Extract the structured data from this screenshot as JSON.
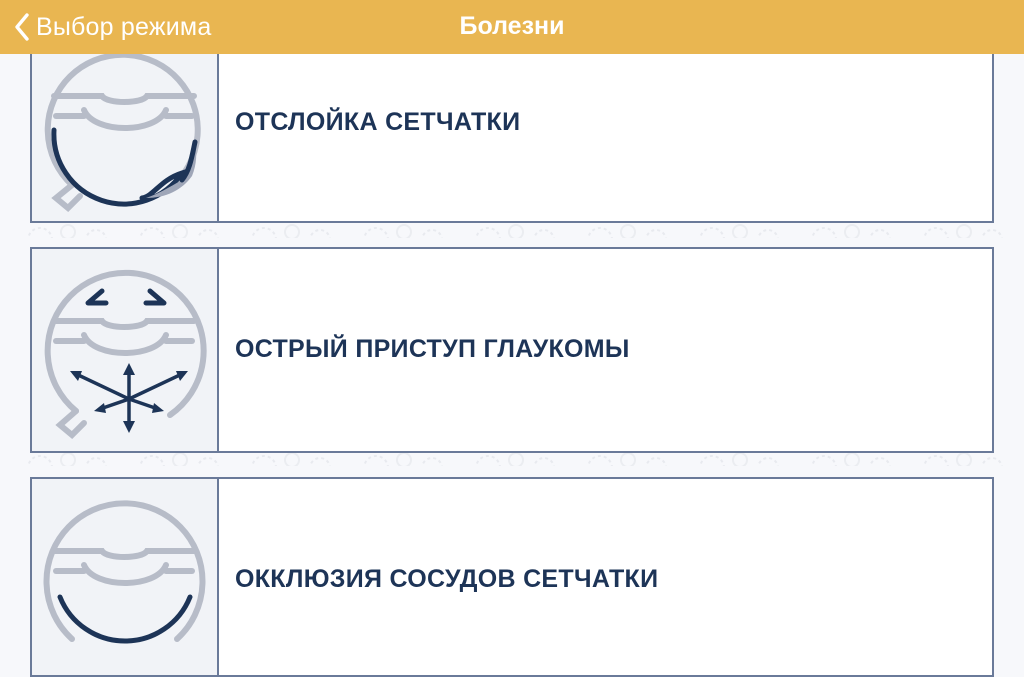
{
  "navbar": {
    "back_label": "Выбор режима",
    "title": "Болезни"
  },
  "diseases": [
    {
      "label": "ОТСЛОЙКА СЕТЧАТКИ",
      "icon": "retinal-detachment-icon"
    },
    {
      "label": "ОСТРЫЙ ПРИСТУП ГЛАУКОМЫ",
      "icon": "glaucoma-attack-icon"
    },
    {
      "label": "ОККЛЮЗИЯ СОСУДОВ СЕТЧАТКИ",
      "icon": "vessel-occlusion-icon"
    }
  ],
  "colors": {
    "navbar": "#e9b651",
    "label_text": "#1d3457",
    "card_border": "#6a7a99",
    "icon_gray": "#b7bcc8",
    "icon_navy": "#1d3457"
  }
}
